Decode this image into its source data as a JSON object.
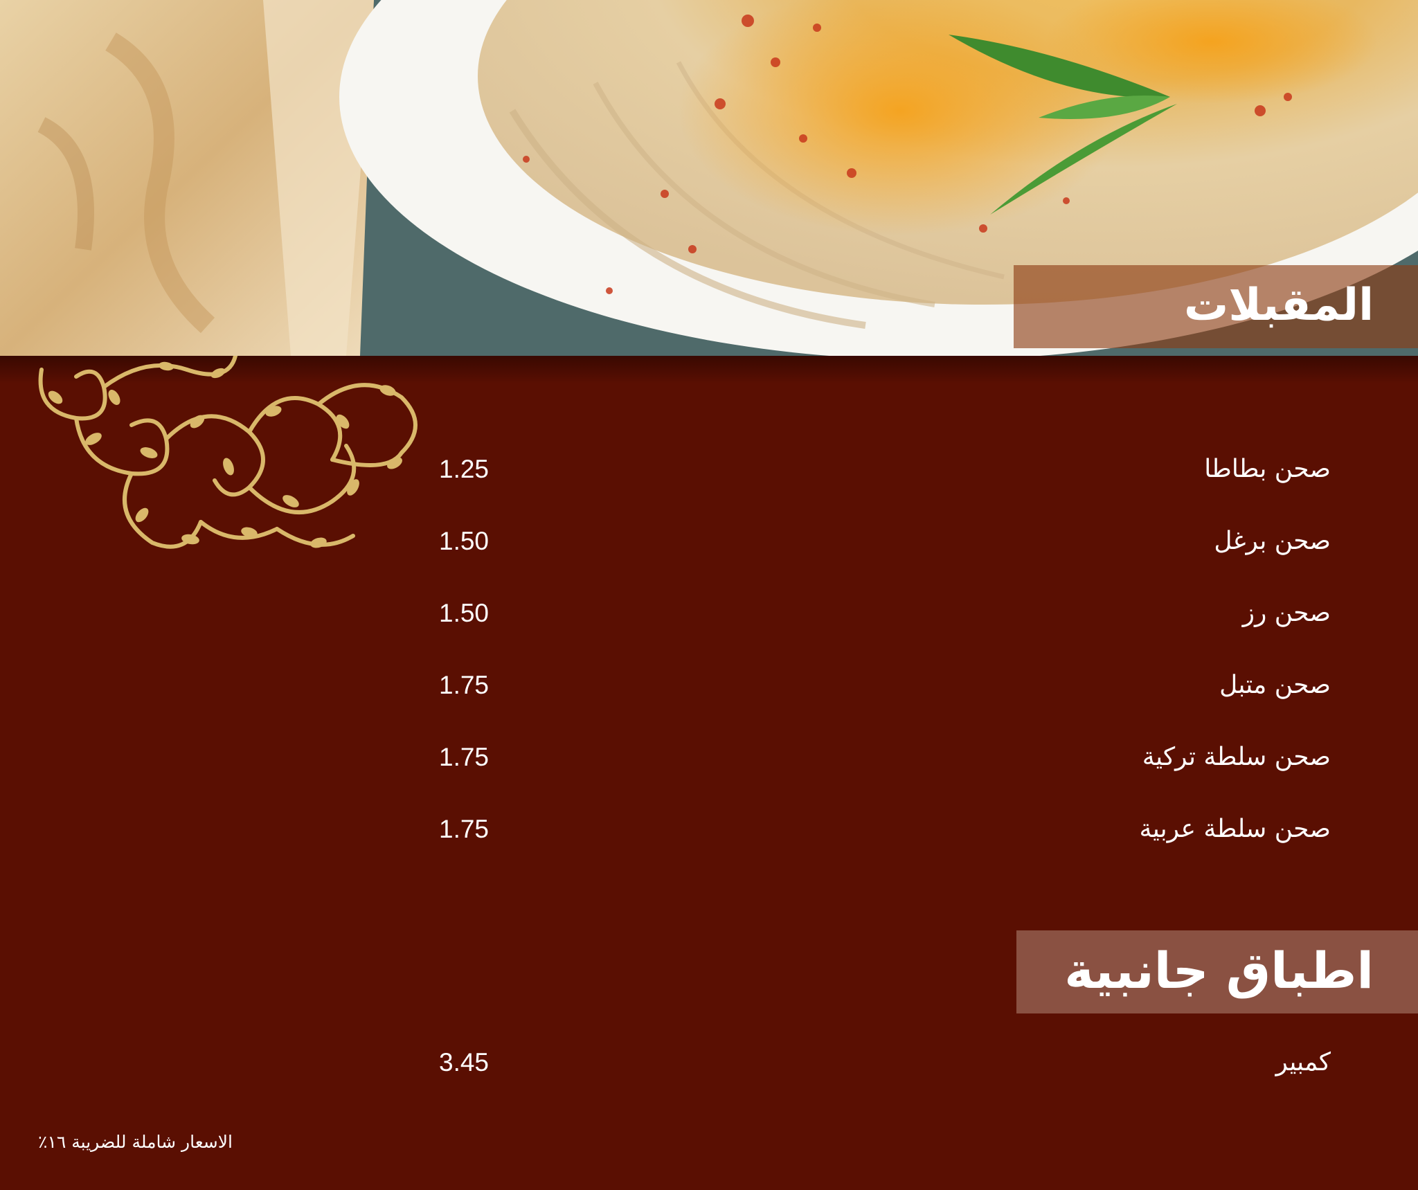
{
  "colors": {
    "background": "#5a0f02",
    "ornament_gold": "#d9b86a",
    "banner_appetizers": "#8c3c14",
    "banner_sides": "#8a5142",
    "text": "#ffffff"
  },
  "hero": {
    "image": "hummus-plate-with-bread-photo"
  },
  "sections": [
    {
      "title": "المقبلات",
      "items": [
        {
          "name": "صحن  بطاطا",
          "price": "1.25"
        },
        {
          "name": "صحن برغل",
          "price": "1.50"
        },
        {
          "name": "صحن رز",
          "price": "1.50"
        },
        {
          "name": "صحن متبل",
          "price": "1.75"
        },
        {
          "name": "صحن سلطة تركية",
          "price": "1.75"
        },
        {
          "name": "صحن سلطة عربية",
          "price": "1.75"
        }
      ]
    },
    {
      "title": "اطباق جانبية",
      "items": [
        {
          "name": "كمبير",
          "price": "3.45"
        }
      ]
    }
  ],
  "footnote": "الاسعار شاملة للضريبة ١٦٪"
}
